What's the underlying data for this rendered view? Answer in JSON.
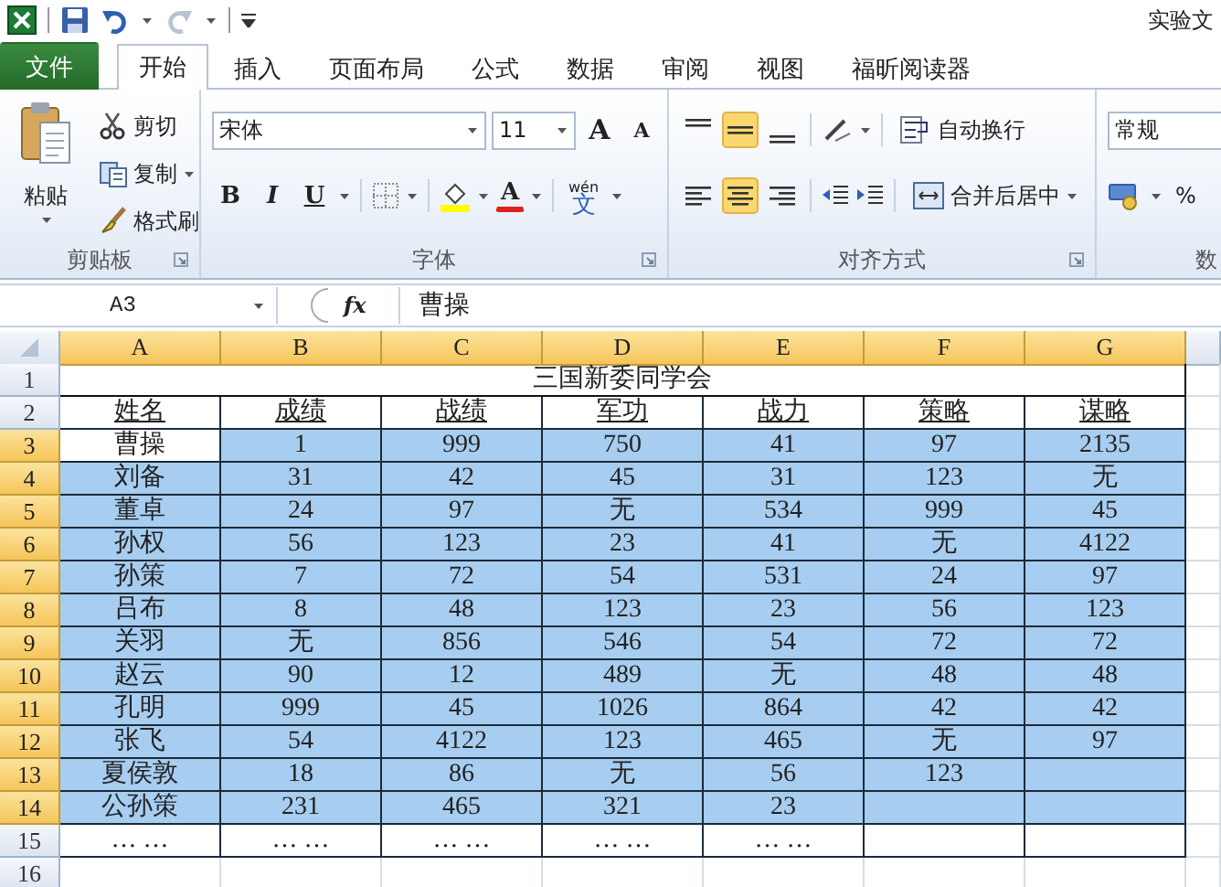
{
  "titlebar": {
    "title": "实验文"
  },
  "tabs": [
    {
      "label": "文件",
      "kind": "file",
      "selected": false
    },
    {
      "label": "开始",
      "kind": "tab",
      "selected": true
    },
    {
      "label": "插入",
      "kind": "tab",
      "selected": false
    },
    {
      "label": "页面布局",
      "kind": "tab",
      "selected": false
    },
    {
      "label": "公式",
      "kind": "tab",
      "selected": false
    },
    {
      "label": "数据",
      "kind": "tab",
      "selected": false
    },
    {
      "label": "审阅",
      "kind": "tab",
      "selected": false
    },
    {
      "label": "视图",
      "kind": "tab",
      "selected": false
    },
    {
      "label": "福昕阅读器",
      "kind": "tab",
      "selected": false
    }
  ],
  "ribbon": {
    "clipboard": {
      "paste": "粘贴",
      "cut": "剪切",
      "copy": "复制",
      "format_painter": "格式刷",
      "label": "剪贴板"
    },
    "font": {
      "name": "宋体",
      "size": "11",
      "grow": "A",
      "shrink": "A",
      "bold": "B",
      "italic": "I",
      "underline": "U",
      "font_color": "A",
      "phonetic_top": "wén",
      "phonetic": "文",
      "label": "字体"
    },
    "alignment": {
      "vertical": [
        {
          "kind": "top",
          "selected": false
        },
        {
          "kind": "middle",
          "selected": true
        },
        {
          "kind": "bottom",
          "selected": false
        }
      ],
      "horizontal": [
        {
          "kind": "left",
          "selected": false
        },
        {
          "kind": "center",
          "selected": true
        },
        {
          "kind": "right",
          "selected": false
        }
      ],
      "wrap": "自动换行",
      "merge": "合并后居中",
      "label": "对齐方式"
    },
    "number": {
      "format": "常规",
      "percent": "%",
      "label": "数"
    }
  },
  "formula_bar": {
    "name_box": "A3",
    "fx": "fx",
    "value": "曹操"
  },
  "sheet": {
    "columns": [
      {
        "label": "A",
        "selected": true
      },
      {
        "label": "B",
        "selected": true
      },
      {
        "label": "C",
        "selected": true
      },
      {
        "label": "D",
        "selected": true
      },
      {
        "label": "E",
        "selected": true
      },
      {
        "label": "F",
        "selected": true
      },
      {
        "label": "G",
        "selected": true
      }
    ],
    "title_row": {
      "number": "1",
      "text": "三国新委同学会"
    },
    "header_row": {
      "number": "2",
      "cells": [
        "姓名",
        "成绩",
        "战绩",
        "军功",
        "战力",
        "策略",
        "谋略"
      ]
    },
    "rows": [
      {
        "number": "3",
        "selected": true,
        "active": true,
        "cells": [
          "曹操",
          "1",
          "999",
          "750",
          "41",
          "97",
          "2135"
        ]
      },
      {
        "number": "4",
        "selected": true,
        "active": false,
        "cells": [
          "刘备",
          "31",
          "42",
          "45",
          "31",
          "123",
          "无"
        ]
      },
      {
        "number": "5",
        "selected": true,
        "active": false,
        "cells": [
          "董卓",
          "24",
          "97",
          "无",
          "534",
          "999",
          "45"
        ]
      },
      {
        "number": "6",
        "selected": true,
        "active": false,
        "cells": [
          "孙权",
          "56",
          "123",
          "23",
          "41",
          "无",
          "4122"
        ]
      },
      {
        "number": "7",
        "selected": true,
        "active": false,
        "cells": [
          "孙策",
          "7",
          "72",
          "54",
          "531",
          "24",
          "97"
        ]
      },
      {
        "number": "8",
        "selected": true,
        "active": false,
        "cells": [
          "吕布",
          "8",
          "48",
          "123",
          "23",
          "56",
          "123"
        ]
      },
      {
        "number": "9",
        "selected": true,
        "active": false,
        "cells": [
          "关羽",
          "无",
          "856",
          "546",
          "54",
          "72",
          "72"
        ]
      },
      {
        "number": "10",
        "selected": true,
        "active": false,
        "cells": [
          "赵云",
          "90",
          "12",
          "489",
          "无",
          "48",
          "48"
        ]
      },
      {
        "number": "11",
        "selected": true,
        "active": false,
        "cells": [
          "孔明",
          "999",
          "45",
          "1026",
          "864",
          "42",
          "42"
        ]
      },
      {
        "number": "12",
        "selected": true,
        "active": false,
        "cells": [
          "张飞",
          "54",
          "4122",
          "123",
          "465",
          "无",
          "97"
        ]
      },
      {
        "number": "13",
        "selected": true,
        "active": false,
        "cells": [
          "夏侯敦",
          "18",
          "86",
          "无",
          "56",
          "123",
          null
        ]
      },
      {
        "number": "14",
        "selected": true,
        "active": false,
        "cells": [
          "公孙策",
          "231",
          "465",
          "321",
          "23",
          null,
          null
        ]
      }
    ],
    "tail_rows": [
      {
        "number": "15",
        "cells": [
          "… …",
          "… …",
          "… …",
          "… …",
          "… …",
          null,
          null
        ]
      },
      {
        "number": "16",
        "cells": [
          null,
          null,
          null,
          null,
          null,
          null,
          null
        ]
      }
    ]
  }
}
